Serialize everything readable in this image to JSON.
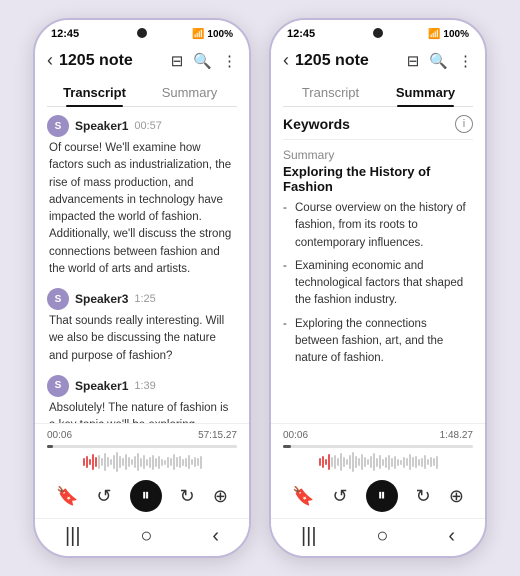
{
  "phone1": {
    "status": {
      "time": "12:45",
      "signal": "●●●",
      "network": "100%"
    },
    "header": {
      "back_label": "‹",
      "title": "1205 note"
    },
    "tabs": [
      {
        "label": "Transcript",
        "active": true
      },
      {
        "label": "Summary",
        "active": false
      }
    ],
    "transcript": [
      {
        "speaker": "Speaker1",
        "time": "00:57",
        "text": "Of course! We'll examine how factors such as industrialization, the rise of mass production, and advancements in technology have impacted the world of fashion. Additionally, we'll discuss the strong connections between fashion and the world of arts and artists."
      },
      {
        "speaker": "Speaker3",
        "time": "1:25",
        "text": "That sounds really interesting. Will we also be discussing the nature and purpose of fashion?"
      },
      {
        "speaker": "Speaker1",
        "time": "1:39",
        "text": "Absolutely! The nature of fashion is a key topic we'll be exploring."
      }
    ],
    "player": {
      "current": "00:06",
      "total": "57:15.27",
      "progress_pct": 3
    }
  },
  "phone2": {
    "status": {
      "time": "12:45",
      "signal": "●●●",
      "network": "100%"
    },
    "header": {
      "back_label": "‹",
      "title": "1205 note"
    },
    "tabs": [
      {
        "label": "Transcript",
        "active": false
      },
      {
        "label": "Summary",
        "active": true
      }
    ],
    "keywords_label": "Keywords",
    "summary": {
      "section_label": "Summary",
      "title": "Exploring the History of Fashion",
      "items": [
        "Course overview on the history of fashion, from its roots to contemporary influences.",
        "Examining economic and technological factors that shaped the fashion industry.",
        "Exploring the connections between fashion, art, and the nature of fashion."
      ]
    },
    "player": {
      "current": "00:06",
      "total": "1:48.27",
      "progress_pct": 4
    }
  },
  "icons": {
    "bookmark": "🔖",
    "back15": "↺",
    "pause": "⏸",
    "fwd15": "↻",
    "save": "⤓",
    "bars": "|||",
    "home": "○",
    "back": "‹"
  }
}
